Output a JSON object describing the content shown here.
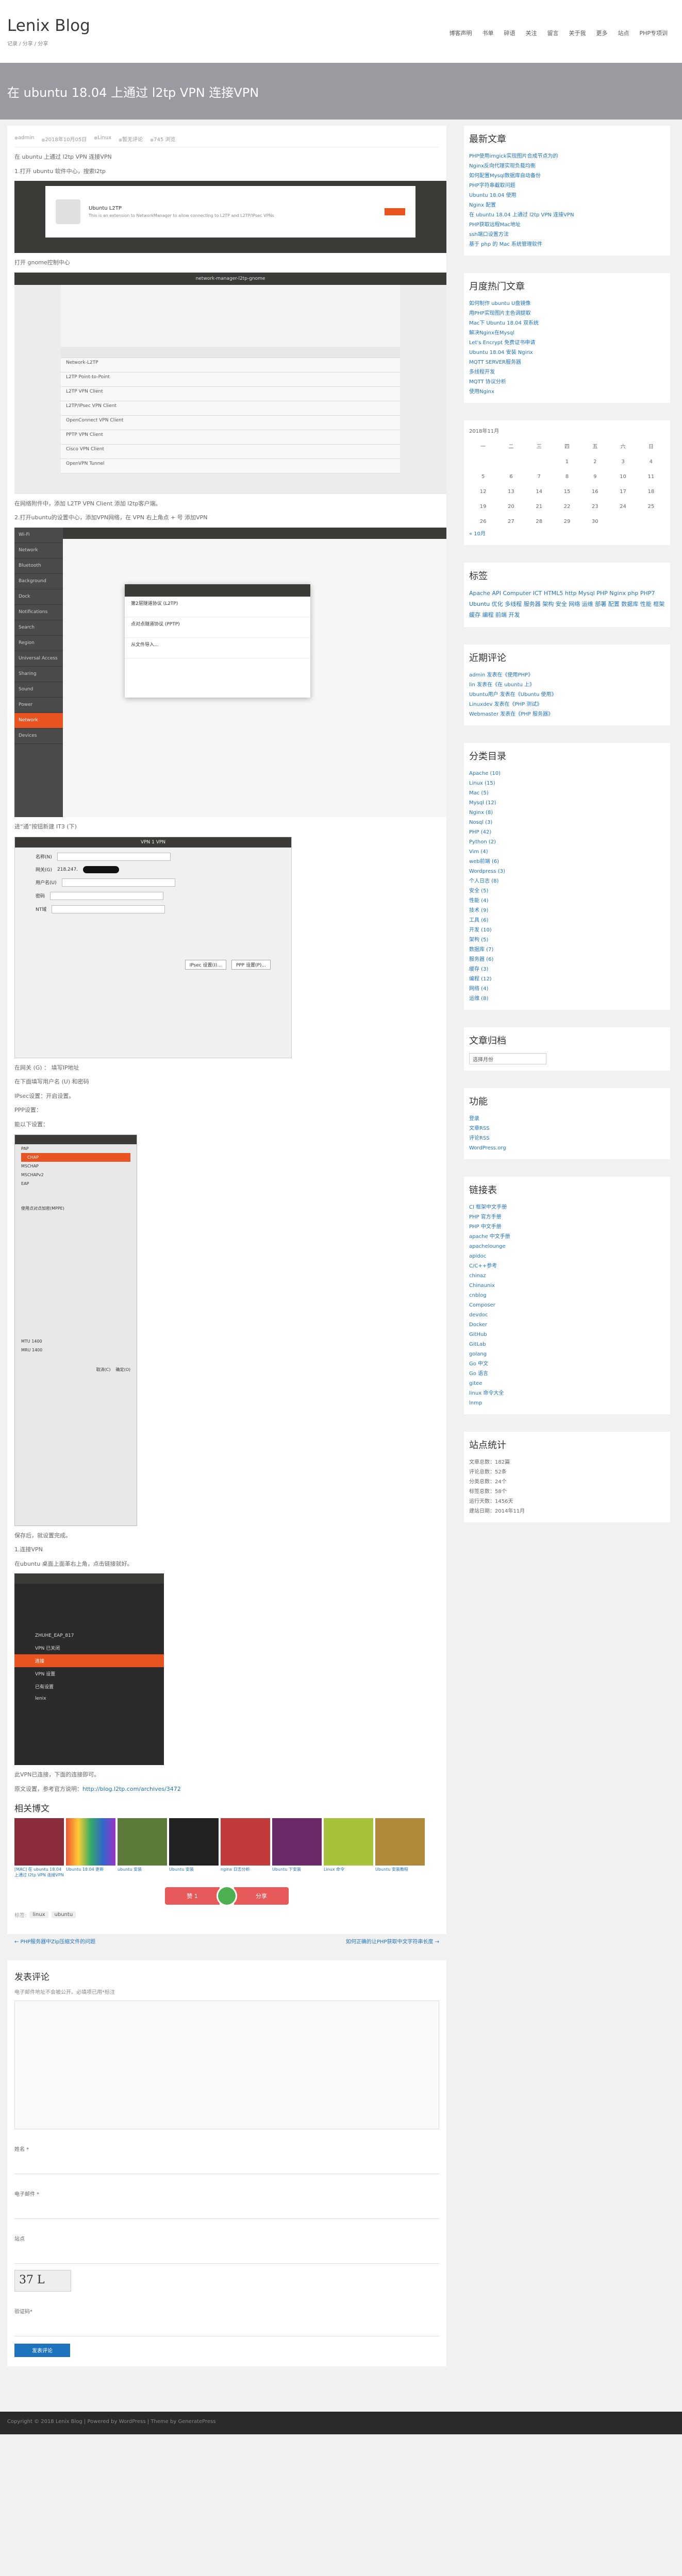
{
  "site": {
    "title": "Lenix Blog",
    "desc": "记录 / 分享 / 分享"
  },
  "nav": [
    "博客声明",
    "书单",
    "碎语",
    "关注",
    "留言",
    "关于我",
    "更多",
    "站点",
    "PHP专项训"
  ],
  "post": {
    "title": "在 ubuntu 18.04 上通过 l2tp VPN 连接VPN",
    "meta": [
      "admin",
      "2018年10月05日",
      "Linux",
      "暂无评论",
      "745 浏览"
    ],
    "p1": "在 ubuntu 上通过 l2tp VPN 连接VPN",
    "p2": "1.打开 ubuntu 软件中心，搜索l2tp",
    "p3": "打开 gnome控制中心",
    "p4": "在网络附件中，添加 L2TP VPN Client 添加 l2tp客户端。",
    "p5": "2.打开ubuntu的设置中心，添加VPN网络，在 VPN 右上角点 + 号 添加VPN",
    "p6": "进“通”按钮新建 IT3 (下)",
    "p7": "在网关 (G) ： 填写IP地址",
    "p8": "在下面填写用户名 (U) 和密码",
    "p9": "IPsec设置：开启设置。",
    "p10": "PPP设置：",
    "p11": "能以下设置：",
    "p12": "保存后，就设置完成。",
    "p13": "1.连接VPN",
    "p14": "在ubuntu 桌面上面革右上角，点击链接就好。",
    "p15": "此VPN已连接，下面的连接即可。",
    "p16": "原文设置，参考官方说明：{{link}}",
    "link": "http://blog.l2tp.com/archives/3472"
  },
  "s1": {
    "name": "Ubuntu L2TP",
    "desc": "This is an extension to NetworkManager to allow connecting to L2TP and L2TP/IPsec VPNs"
  },
  "s2": {
    "title": "network-manager-l2tp-gnome",
    "rows": [
      "Network-L2TP",
      "L2TP Point-to-Point",
      "L2TP VPN Client",
      "L2TP/IPsec VPN Client",
      "OpenConnect VPN Client",
      "PPTP VPN Client",
      "Cisco VPN Client",
      "OpenVPN Tunnel"
    ]
  },
  "s3": {
    "side": [
      "Wi-Fi",
      "Network",
      "Bluetooth",
      "Background",
      "Dock",
      "Notifications",
      "Search",
      "Region",
      "Universal Access",
      "Sharing",
      "Sound",
      "Power",
      "Network",
      "Devices"
    ],
    "dlg": [
      "第2层隧道协议 (L2TP)",
      "点对点隧道协议 (PPTP)",
      "从文件导入..."
    ]
  },
  "s4": {
    "title": "VPN 1 VPN",
    "fields": [
      "名称(N)",
      "网关(G)",
      "用户名(U)",
      "密码",
      "NT域"
    ],
    "name": "VPN 1",
    "gw": "218.247.",
    "btn1": "IPsec 设置(I)...",
    "btn2": "PPP 设置(P)..."
  },
  "s5": {
    "title": "L2TP PPP 选项",
    "auth": [
      "PAP",
      "CHAP",
      "MSCHAP",
      "MSCHAPv2",
      "EAP"
    ],
    "mppe": "使用点对点加密(MPPE)",
    "mtu": "MTU",
    "mru": "MRU",
    "mtuv": "1400",
    "mruv": "1400",
    "cancel": "取消(C)",
    "ok": "确定(O)"
  },
  "s6": {
    "items": [
      "ZHUHE_EAP_817",
      "VPN 已关闭",
      "连接",
      "VPN 设置",
      "已有设置",
      "lenix"
    ]
  },
  "related": {
    "title": "相关博文",
    "items": [
      "[MAC] 在 ubuntu 18.04 上通过 l2tp VPN 连接VPN",
      "Ubuntu 18.04 更新",
      "ubuntu 安装",
      "Ubuntu 安装",
      "nginx 日志分析",
      "Ubuntu 下安装",
      "Linux 命令",
      "Ubuntu 安装教程"
    ]
  },
  "share": {
    "left": "赞 1",
    "right": "分享"
  },
  "tags": {
    "label": "标签:",
    "items": [
      "linux",
      "ubuntu"
    ]
  },
  "postnav": {
    "prev": "← PHP服务器中Zip压缩文件的问题",
    "next": "如何正确的让PHP获取中文字符串长度 →"
  },
  "comment": {
    "title": "发表评论",
    "note": "电子邮件地址不会被公开。必填项已用*标注",
    "name": "姓名 *",
    "email": "电子邮件 *",
    "site": "站点",
    "captcha": "37 L",
    "captcha_label": "验证码*",
    "submit": "发表评论"
  },
  "widgets": {
    "recent_title": "最新文章",
    "recent": [
      "PHP使用imgick实现图片合成节点为的",
      "Nginx反向代理实现负载均衡",
      "如何配置Mysql数据库自动备份",
      "PHP字符串截取问题",
      "Ubuntu 18.04 使用",
      "Nginx 配置",
      "在 ubuntu 18.04 上通过 l2tp VPN 连接VPN",
      "PHP获取远程Mac地址",
      "ssh端口设置方法",
      "基于 php 的 Mac 系统管理软件"
    ],
    "hot_title": "月度热门文章",
    "hot": [
      "如何制作 ubuntu U盘镜像",
      "用PHP实现图片主色调提取",
      "Mac下 Ubuntu 18.04 双系统",
      "解决Nginx在Mysql",
      "Let's Encrypt 免费证书申请",
      "Ubuntu 18.04 安装 Nginx",
      "MQTT SERVER服务器",
      "多线程开发",
      "MQTT 协议分析",
      "使用Nginx"
    ],
    "cal": {
      "title": "2018年11月",
      "head": [
        "一",
        "二",
        "三",
        "四",
        "五",
        "六",
        "日"
      ],
      "rows": [
        [
          "",
          "",
          "",
          "1",
          "2",
          "3",
          "4"
        ],
        [
          "5",
          "6",
          "7",
          "8",
          "9",
          "10",
          "11"
        ],
        [
          "12",
          "13",
          "14",
          "15",
          "16",
          "17",
          "18"
        ],
        [
          "19",
          "20",
          "21",
          "22",
          "23",
          "24",
          "25"
        ],
        [
          "26",
          "27",
          "28",
          "29",
          "30",
          "",
          ""
        ]
      ],
      "prev": "« 10月"
    },
    "tags_title": "标签",
    "tagcloud": "Apache API Computer ICT HTML5 http Mysql PHP Nginx php PHP7 Ubuntu 优化 多线程 服务器 架构 安全 网络 运维 部署 配置 数据库 性能 框架 缓存 编程 前端 开发",
    "comments_title": "近期评论",
    "comments": [
      "admin 发表在《使用PHP》",
      "lin 发表在《在 ubuntu 上》",
      "Ubuntu用户 发表在《Ubuntu 使用》",
      "Linuxdev 发表在《PHP 测试》",
      "Webmaster 发表在《PHP 服务器》"
    ],
    "cat_title": "分类目录",
    "cats": [
      "Apache (10)",
      "Linux (15)",
      "Mac (5)",
      "Mysql (12)",
      "Nginx (8)",
      "Nosql (3)",
      "PHP (42)",
      "Python (2)",
      "Vim (4)",
      "web前端 (6)",
      "Wordpress (3)",
      "个人日志 (8)",
      "安全 (5)",
      "性能 (4)",
      "技术 (9)",
      "工具 (6)",
      "开发 (10)",
      "架构 (5)",
      "数据库 (7)",
      "服务器 (6)",
      "缓存 (3)",
      "编程 (12)",
      "网络 (4)",
      "运维 (8)"
    ],
    "arch_title": "文章归档",
    "arch_sel": "选择月份",
    "func_title": "功能",
    "func": [
      "登录",
      "文章RSS",
      "评论RSS",
      "WordPress.org"
    ],
    "links_title": "链接表",
    "links": [
      "CI 框架中文手册",
      "PHP 官方手册",
      "PHP 中文手册",
      "apache 中文手册",
      "apachelounge",
      "apidoc",
      "C/C++参考",
      "chinaz",
      "Chinaunix",
      "cnblog",
      "Composer",
      "devdoc",
      "Docker",
      "GitHub",
      "GitLab",
      "golang",
      "Go 中文",
      "Go 语言",
      "gitee",
      "linux 命令大全",
      "lnmp"
    ],
    "stat_title": "站点统计",
    "stat": [
      "文章总数：182篇",
      "评论总数：52条",
      "分类总数：24个",
      "标签总数：58个",
      "运行天数：1456天",
      "建站日期：2014年11月"
    ]
  },
  "footer": "Copyright © 2018 Lenix Blog | Powered by WordPress | Theme by GeneratePress"
}
